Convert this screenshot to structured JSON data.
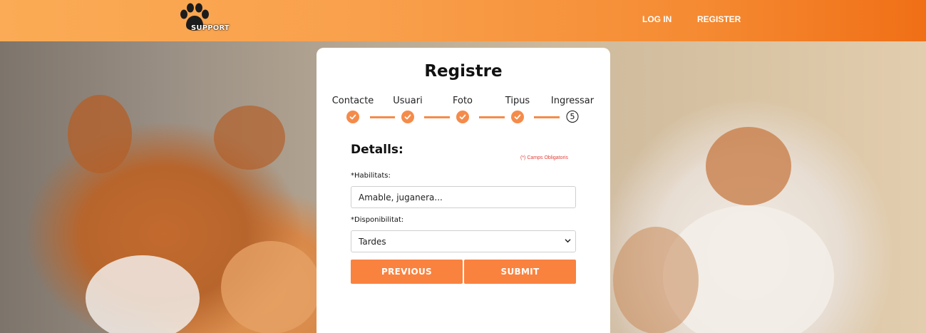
{
  "header": {
    "logo_text": "SUPPORT",
    "nav": [
      {
        "label": "LOG IN"
      },
      {
        "label": "REGISTER"
      }
    ]
  },
  "card": {
    "title": "Registre",
    "steps": [
      {
        "label": "Contacte",
        "state": "done"
      },
      {
        "label": "Usuari",
        "state": "done"
      },
      {
        "label": "Foto",
        "state": "done"
      },
      {
        "label": "Tipus",
        "state": "done"
      },
      {
        "label": "Ingressar",
        "state": "current",
        "number": "5"
      }
    ],
    "section_title": "Detalls:",
    "required_note": "(*) Camps Obligatoris",
    "fields": {
      "habilitats": {
        "label": "*Habilitats:",
        "value": "Amable, juganera..."
      },
      "disponibilitat": {
        "label": "*Disponibilitat:",
        "value": "Tardes"
      }
    },
    "buttons": {
      "previous": "PREVIOUS",
      "submit": "SUBMIT"
    }
  },
  "colors": {
    "accent": "#f9823f",
    "header_start": "#fbab55",
    "header_end": "#f06f16",
    "required": "#e0423b"
  }
}
